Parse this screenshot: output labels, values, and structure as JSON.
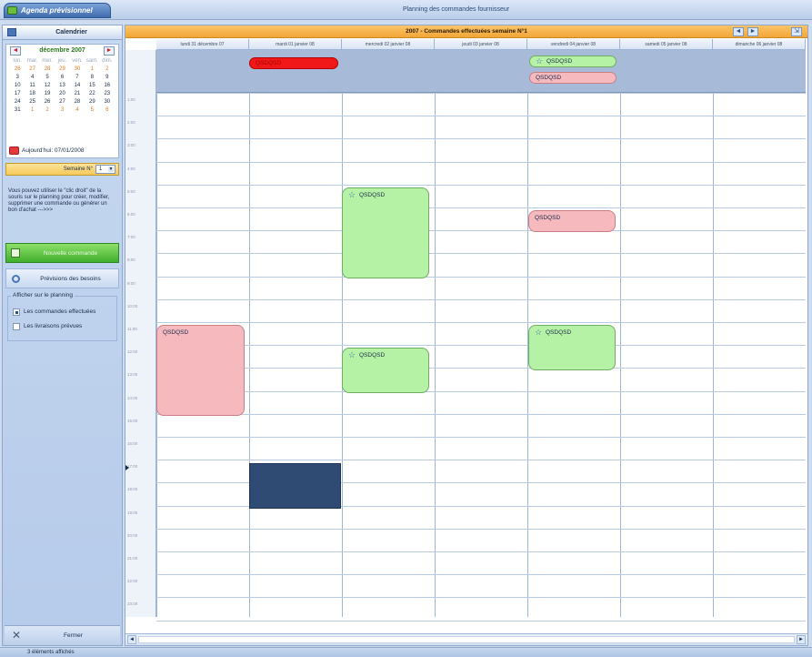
{
  "app": {
    "tab_label": "Agenda prévisionnel",
    "window_title": "Planning des commandes fournisseur",
    "status_text": "3 éléments affichés"
  },
  "sidebar": {
    "header": "Calendrier",
    "mini_calendar": {
      "month_label": "décembre 2007",
      "prev_label": "◄",
      "next_label": "►",
      "day_headers": [
        "lun.",
        "mar.",
        "mer.",
        "jeu.",
        "ven.",
        "sam.",
        "dim."
      ],
      "weeks": [
        [
          "26",
          "27",
          "28",
          "29",
          "30",
          "1",
          "2"
        ],
        [
          "3",
          "4",
          "5",
          "6",
          "7",
          "8",
          "9"
        ],
        [
          "10",
          "11",
          "12",
          "13",
          "14",
          "15",
          "16"
        ],
        [
          "17",
          "18",
          "19",
          "20",
          "21",
          "22",
          "23"
        ],
        [
          "24",
          "25",
          "26",
          "27",
          "28",
          "29",
          "30"
        ],
        [
          "31",
          "1",
          "2",
          "3",
          "4",
          "5",
          "6"
        ]
      ],
      "today_label": "Aujourd'hui: 07/01/2008"
    },
    "week": {
      "label": "Semaine N°",
      "value": "1"
    },
    "help_text": "Vous pouvez utiliser le \"clic droit\" de la souris sur le planning pour créer, modifier, supprimer une commande ou générer un bon d'achat --->>>",
    "new_order_label": "Nouvelle commande",
    "forecast_label": "Prévisions des besoins",
    "filters": {
      "legend": "Afficher sur le planning",
      "items": [
        {
          "label": "Les commandes effectuées",
          "checked": true
        },
        {
          "label": "Les livraisons prévues",
          "checked": false
        }
      ]
    },
    "close_label": "Fermer"
  },
  "planning": {
    "title": "2007 - Commandes effectuées semaine N°1",
    "nav": {
      "prev": "◄",
      "next": "►",
      "today": "⇲"
    },
    "columns": [
      "lundi 31 décembre 07",
      "mardi 01 janvier 08",
      "mercredi 02 janvier 08",
      "jeudi 03 janvier 08",
      "vendredi 04 janvier 08",
      "samedi 05 janvier 08",
      "dimanche 06 janvier 08"
    ],
    "time_labels": [
      "1:00",
      "2:00",
      "3:00",
      "4:00",
      "5:00",
      "6:00",
      "7:00",
      "8:00",
      "9:00",
      "10:00",
      "11:00",
      "12:00",
      "13:00",
      "14:00",
      "15:00",
      "16:00",
      "17:00",
      "18:00",
      "19:00",
      "20:00",
      "21:00",
      "22:00",
      "23:00"
    ],
    "events": {
      "allday_red": "QSDQSD",
      "allday_fri_green": "QSDQSD",
      "allday_fri_pink": "QSDQSD",
      "wed_0400": "QSDQSD",
      "wed_1100": "QSDQSD",
      "mon_1000": "QSDQSD",
      "fri_0500": "QSDQSD",
      "fri_1000": "QSDQSD"
    },
    "colors": {
      "header_orange": "#f3a536",
      "event_green": "#b6f2a6",
      "event_pink": "#f6b9bd",
      "event_red": "#f01818",
      "selection_navy": "#2f4a73"
    }
  }
}
